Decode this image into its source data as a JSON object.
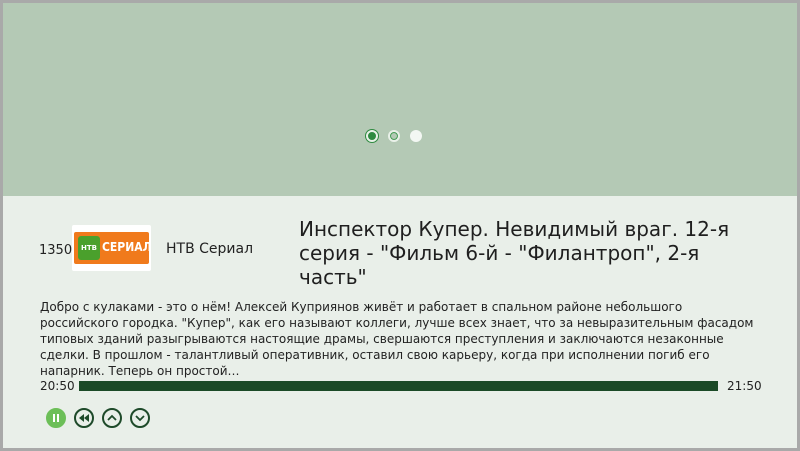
{
  "hero": {
    "carousel": {
      "count": 3,
      "active": 0
    }
  },
  "program": {
    "number": "1350",
    "logo_label": "СЕРИАЛ",
    "logo_badge": "НТВ",
    "channel": "НТВ Сериал",
    "title": "Инспектор Купер. Невидимый враг. 12-я серия - \"Фильм 6-й - \"Филантроп\", 2-я часть\"",
    "description": "Добро с кулаками - это о нём! Алексей Куприянов живёт и работает в спальном районе небольшого российского городка. \"Купер\", как его называют коллеги, лучше всех знает, что за невыразительным фасадом типовых зданий разыгрываются настоящие драмы, свершаются преступления и заключаются незаконные сделки. В прошлом - талантливый оперативник, оставил свою карьеру, когда при исполнении погиб его напарник. Теперь он простой…"
  },
  "playback": {
    "start_time": "20:50",
    "end_time": "21:50",
    "progress": 1.0
  },
  "colors": {
    "hero_bg": "#b4c9b5",
    "panel_bg": "#e9efe9",
    "accent": "#2e8a40",
    "progress_fill": "#1b4a27"
  },
  "icons": {
    "pause": "pause-icon",
    "rewind": "rewind-icon",
    "up": "chevron-up-icon",
    "down": "chevron-down-icon"
  }
}
